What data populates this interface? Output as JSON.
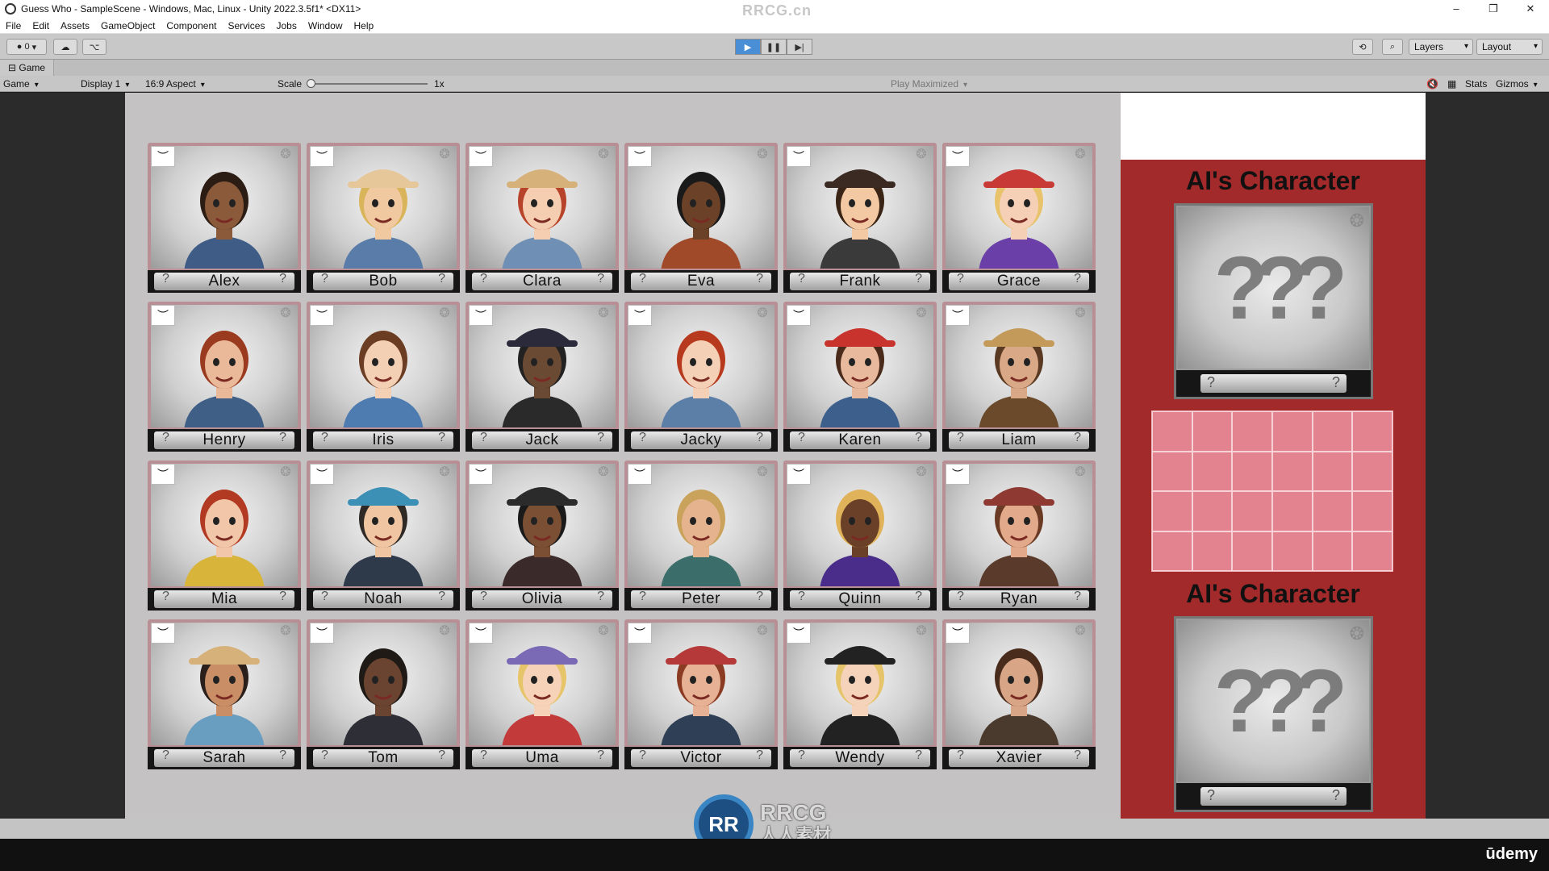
{
  "window": {
    "title": "Guess Who - SampleScene - Windows, Mac, Linux - Unity 2022.3.5f1* <DX11>",
    "center_watermark": "RRCG.cn",
    "buttons": [
      "–",
      "❐",
      "✕"
    ]
  },
  "menu": [
    "File",
    "Edit",
    "Assets",
    "GameObject",
    "Component",
    "Services",
    "Jobs",
    "Window",
    "Help"
  ],
  "toolbar": {
    "account_count": "0",
    "layers_label": "Layers",
    "layout_label": "Layout"
  },
  "game_tab": {
    "label": "Game"
  },
  "game_controls": {
    "view": "Game",
    "display": "Display 1",
    "aspect": "16:9 Aspect",
    "scale_label": "Scale",
    "scale_value": "1x",
    "play_mode": "Play Maximized",
    "stats": "Stats",
    "gizmos": "Gizmos"
  },
  "characters": [
    "Alex",
    "Bob",
    "Clara",
    "Eva",
    "Frank",
    "Grace",
    "Henry",
    "Iris",
    "Jack",
    "Jacky",
    "Karen",
    "Liam",
    "Mia",
    "Noah",
    "Olivia",
    "Peter",
    "Quinn",
    "Ryan",
    "Sarah",
    "Tom",
    "Uma",
    "Victor",
    "Wendy",
    "Xavier"
  ],
  "card_colors": {
    "hair": [
      "#2b1d14",
      "#d9b45a",
      "#b8432b",
      "#1a1a1a",
      "#3a2415",
      "#e8c36b",
      "#9a3b1f",
      "#6b3d22",
      "#222222",
      "#b83a1e",
      "#4a2a1a",
      "#5a3a22",
      "#b23a22",
      "#2f2a26",
      "#1a1a1a",
      "#c9a25b",
      "#e0b35a",
      "#6a3a24",
      "#2a1f1a",
      "#1f1a16",
      "#e6c46a",
      "#8a3b22",
      "#e6c46a",
      "#4a2c1c"
    ],
    "skin": [
      "#8a5a3b",
      "#f0c9a0",
      "#f5cdb0",
      "#6b4227",
      "#f2c9a2",
      "#f5d0b6",
      "#e9b99a",
      "#f3cfb4",
      "#6b4a33",
      "#f3d0b6",
      "#e8b99d",
      "#d9a886",
      "#f2c6a8",
      "#f0c6a2",
      "#7a4f33",
      "#e6b38f",
      "#6a4128",
      "#e2a98a",
      "#c98e66",
      "#6a4430",
      "#f5d2b8",
      "#e6b194",
      "#f5d3ba",
      "#d8a587"
    ],
    "hat": [
      "",
      "#e6c79a",
      "#d6b27a",
      "",
      "#3a2a22",
      "#c83a36",
      "",
      "",
      "#2a2a3a",
      "",
      "#c8332d",
      "#c49a5a",
      "",
      "#3c8fb5",
      "#2b2b2b",
      "",
      "",
      "#8e3a32",
      "#d6b27a",
      "",
      "#7a6ab5",
      "#b6393a",
      "#222222",
      ""
    ],
    "shirt": [
      "#3e5c86",
      "#5a7ca8",
      "#6f8fb5",
      "#a14a2a",
      "#3a3a3a",
      "#6a3fa8",
      "#3f5f86",
      "#4e7bb0",
      "#2a2a2a",
      "#5c7fa8",
      "#3d5f8c",
      "#6a4a2a",
      "#d8b43a",
      "#2e3a4a",
      "#3a2a2a",
      "#3b6e6a",
      "#4a2d8a",
      "#5a3a2a",
      "#6a9ec0",
      "#2e2e36",
      "#c23a3a",
      "#2f3f55",
      "#222222",
      "#4a3a2e"
    ]
  },
  "ai_panel": {
    "title_top": "AI's Character",
    "title_bottom": "AI's Character",
    "question_marks": "???"
  },
  "placeholder_q": "?",
  "icons": {
    "eye": "closed-eye-icon",
    "brain": "brain-icon"
  },
  "bottom_logo": {
    "badge": "RR",
    "line1": "RRCG",
    "line2": "人人素材"
  },
  "brand": "ūdemy"
}
